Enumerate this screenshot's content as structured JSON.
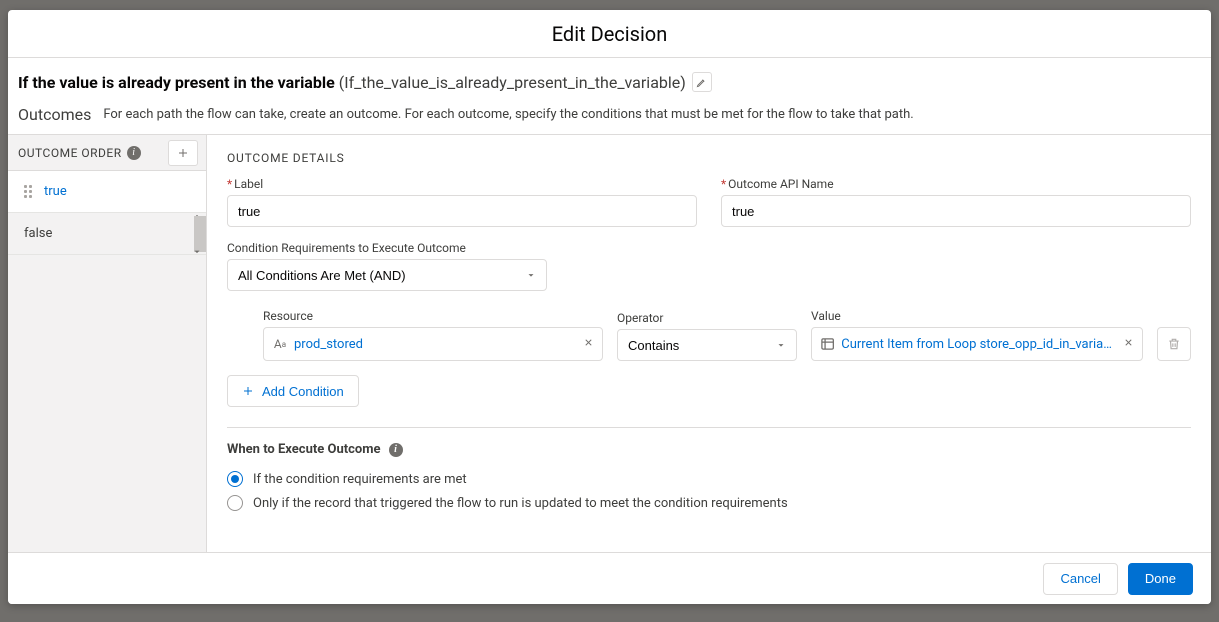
{
  "modal_title": "Edit Decision",
  "decision": {
    "label": "If the value is already present in the variable",
    "api_name": "(If_the_value_is_already_present_in_the_variable)"
  },
  "outcomes_section": {
    "heading": "Outcomes",
    "desc": "For each path the flow can take, create an outcome. For each outcome, specify the conditions that must be met for the flow to take that path."
  },
  "outcome_order": {
    "header": "OUTCOME ORDER",
    "items": [
      {
        "label": "true",
        "active": true,
        "draggable": true
      },
      {
        "label": "false",
        "active": false,
        "draggable": false
      }
    ]
  },
  "details": {
    "heading": "OUTCOME DETAILS",
    "label_field": {
      "label": "Label",
      "value": "true"
    },
    "api_field": {
      "label": "Outcome API Name",
      "value": "true"
    },
    "cond_req_label": "Condition Requirements to Execute Outcome",
    "cond_req_value": "All Conditions Are Met (AND)",
    "condition": {
      "resource_label": "Resource",
      "resource_value": "prod_stored",
      "operator_label": "Operator",
      "operator_value": "Contains",
      "value_label": "Value",
      "value_pill": "Current Item from Loop store_opp_id_in_variable..."
    },
    "add_condition": "Add Condition",
    "exec_heading": "When to Execute Outcome",
    "exec_options": [
      {
        "label": "If the condition requirements are met",
        "checked": true
      },
      {
        "label": "Only if the record that triggered the flow to run is updated to meet the condition requirements",
        "checked": false
      }
    ]
  },
  "footer": {
    "cancel": "Cancel",
    "done": "Done"
  }
}
